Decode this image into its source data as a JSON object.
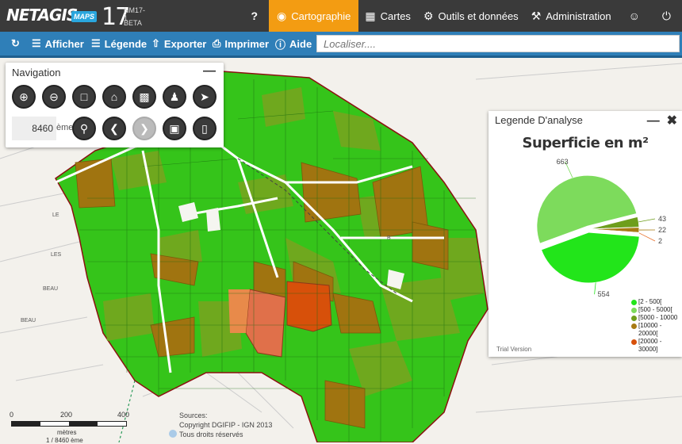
{
  "app": {
    "name": "NETAGIS",
    "maps": "MAPS",
    "num": "17",
    "version": "NM17-1",
    "beta": "BETA"
  },
  "topnav": [
    {
      "label": "",
      "icon": "?"
    },
    {
      "label": "Cartographie",
      "icon": "◉"
    },
    {
      "label": "Cartes",
      "icon": "▦"
    },
    {
      "label": "Outils et données",
      "icon": "⚙"
    },
    {
      "label": "Administration",
      "icon": "⚒"
    },
    {
      "label": "",
      "icon": "☺"
    },
    {
      "label": "",
      "icon": "⏻"
    }
  ],
  "toolbar": {
    "refresh_icon": "↻",
    "afficher": "Afficher",
    "legende": "Légende",
    "exporter": "Exporter",
    "imprimer": "Imprimer",
    "aide": "Aide",
    "search_placeholder": "Localiser...."
  },
  "navigation": {
    "title": "Navigation",
    "minimize": "—",
    "scale_value": "8460",
    "scale_unit": "ème"
  },
  "legend": {
    "title": "Legende D'analyse",
    "minimize": "—",
    "close": "✖",
    "chart_title": "Superficie en m²",
    "trial": "Trial Version"
  },
  "chart_data": {
    "type": "pie",
    "title": "Superficie en m²",
    "slices": [
      {
        "name": "[2 - 500[",
        "value": 554,
        "color": "#22e51a"
      },
      {
        "name": "[500 - 5000[",
        "value": 663,
        "color": "#7ddb5c"
      },
      {
        "name": "[5000 - 10000[",
        "value": 43,
        "color": "#6e9e1c"
      },
      {
        "name": "[10000 - 20000[",
        "value": 22,
        "color": "#a87b14"
      },
      {
        "name": "[20000 - 30000]",
        "value": 2,
        "color": "#e8702a"
      }
    ],
    "legend_labels": [
      "[2 - 500[",
      "[500 - 5000[",
      "[5000 - 10000",
      "[10000 -",
      "20000[",
      "[20000 -",
      "30000]"
    ]
  },
  "map": {
    "labels": [
      "LE",
      "LES",
      "BEAU",
      "BEAU",
      "B"
    ],
    "scalebar": {
      "ticks": [
        "0",
        "200",
        "400"
      ],
      "unit": "mètres",
      "scale": "1 / 8460 ème"
    },
    "sources": [
      "Sources:",
      "Copyright DGIFIP - IGN 2013",
      "Tous droits réservés"
    ]
  }
}
